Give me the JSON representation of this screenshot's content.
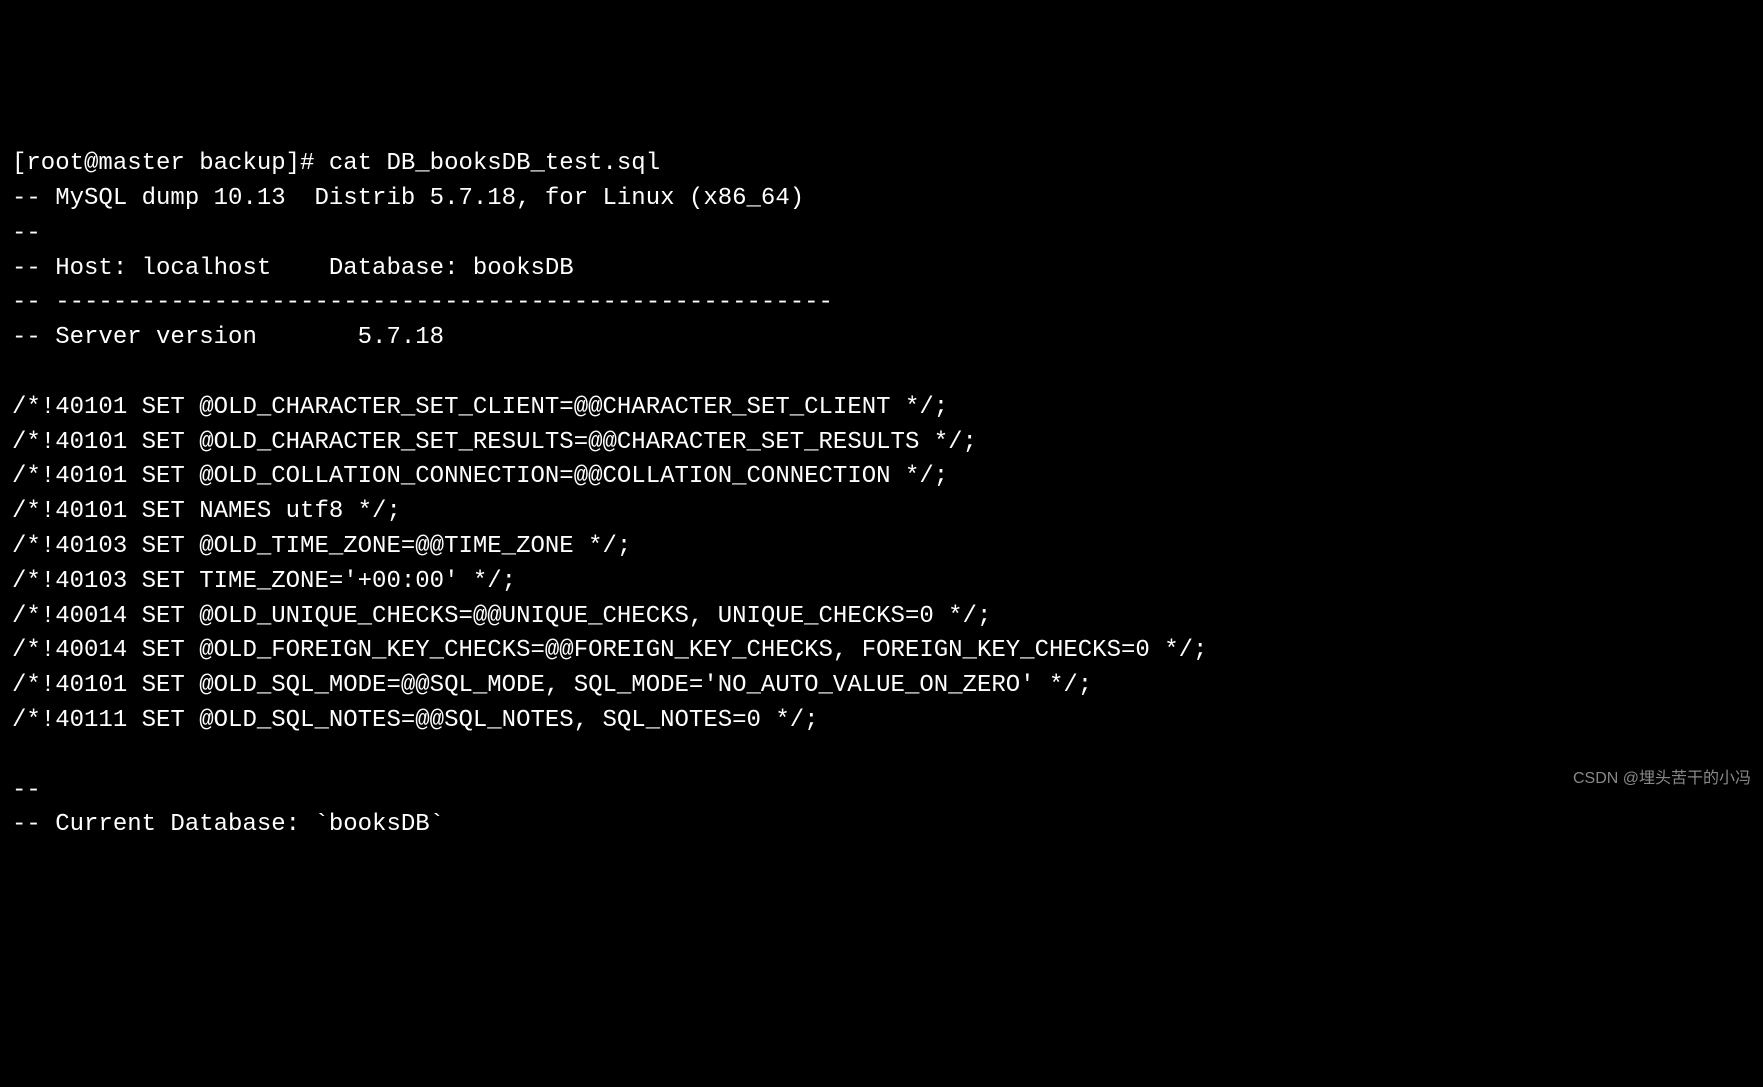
{
  "terminal": {
    "lines": [
      "[root@master backup]# cat DB_booksDB_test.sql",
      "-- MySQL dump 10.13  Distrib 5.7.18, for Linux (x86_64)",
      "--",
      "-- Host: localhost    Database: booksDB",
      "-- ------------------------------------------------------",
      "-- Server version       5.7.18",
      "",
      "/*!40101 SET @OLD_CHARACTER_SET_CLIENT=@@CHARACTER_SET_CLIENT */;",
      "/*!40101 SET @OLD_CHARACTER_SET_RESULTS=@@CHARACTER_SET_RESULTS */;",
      "/*!40101 SET @OLD_COLLATION_CONNECTION=@@COLLATION_CONNECTION */;",
      "/*!40101 SET NAMES utf8 */;",
      "/*!40103 SET @OLD_TIME_ZONE=@@TIME_ZONE */;",
      "/*!40103 SET TIME_ZONE='+00:00' */;",
      "/*!40014 SET @OLD_UNIQUE_CHECKS=@@UNIQUE_CHECKS, UNIQUE_CHECKS=0 */;",
      "/*!40014 SET @OLD_FOREIGN_KEY_CHECKS=@@FOREIGN_KEY_CHECKS, FOREIGN_KEY_CHECKS=0 */;",
      "/*!40101 SET @OLD_SQL_MODE=@@SQL_MODE, SQL_MODE='NO_AUTO_VALUE_ON_ZERO' */;",
      "/*!40111 SET @OLD_SQL_NOTES=@@SQL_NOTES, SQL_NOTES=0 */;",
      "",
      "--",
      "-- Current Database: `booksDB`"
    ]
  },
  "watermark": "CSDN @埋头苦干的小冯"
}
